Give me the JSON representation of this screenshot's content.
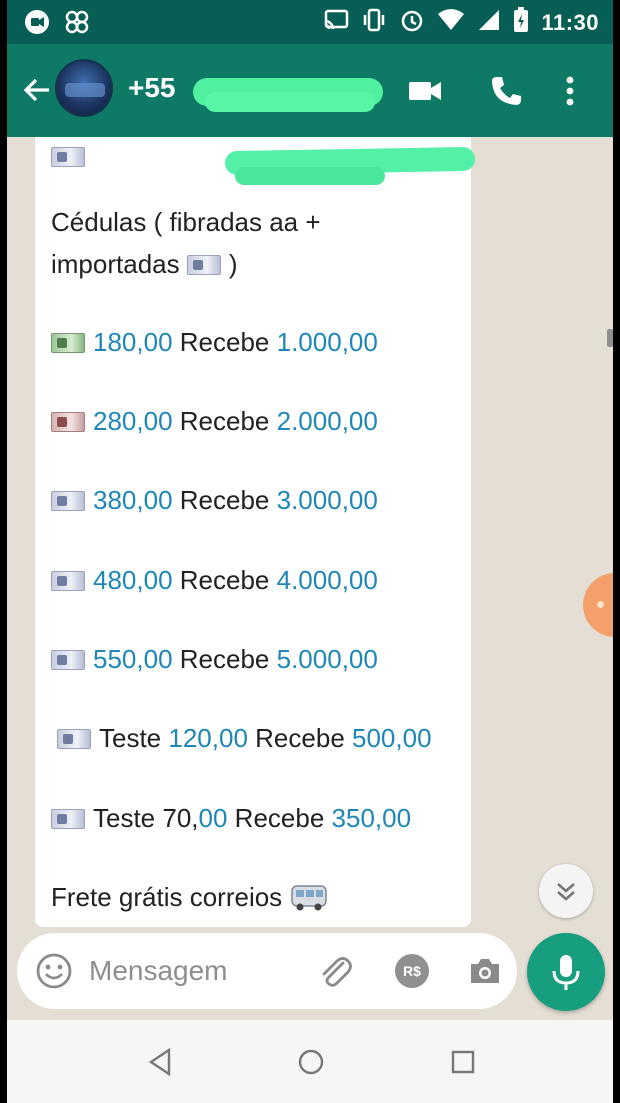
{
  "status_bar": {
    "time": "11:30",
    "icons": [
      "whatsapp-notification-icon",
      "fan-icon",
      "cast-icon",
      "vibrate-icon",
      "alarm-icon",
      "wifi-icon",
      "signal-icon",
      "battery-charging-icon"
    ]
  },
  "app_bar": {
    "contact_prefix": "+55",
    "icons": [
      "back-arrow-icon",
      "video-call-icon",
      "phone-icon",
      "more-vert-icon"
    ]
  },
  "message": {
    "intro_line1": "Cédulas ( fibradas aa +",
    "intro_line2": "importadas",
    "intro_close": ")",
    "offers": [
      {
        "pre": "",
        "price": "180,00",
        "recebe": "Recebe",
        "amount": "1.000,00",
        "bill": "green"
      },
      {
        "pre": "",
        "price": "280,00",
        "recebe": "Recebe",
        "amount": "2.000,00",
        "bill": "red"
      },
      {
        "pre": "",
        "price": "380,00",
        "recebe": "Recebe",
        "amount": "3.000,00",
        "bill": "blue"
      },
      {
        "pre": "",
        "price": "480,00",
        "recebe": "Recebe",
        "amount": "4.000,00",
        "bill": "blue"
      },
      {
        "pre": "",
        "price": "550,00",
        "recebe": "Recebe",
        "amount": "5.000,00",
        "bill": "blue"
      }
    ],
    "teste1": {
      "label": "Teste",
      "price": "120,00",
      "recebe": "Recebe",
      "amount": "500,00"
    },
    "teste2": {
      "label": "Teste 70,",
      "price": "00",
      "recebe": "Recebe",
      "amount": "350,00"
    },
    "frete": "Frete grátis correios"
  },
  "composer": {
    "placeholder": "Mensagem",
    "rs_label": "R$"
  },
  "colors": {
    "header": "#0e7a66",
    "status": "#075e54",
    "number": "#1f86b8",
    "mic": "#179e7f"
  }
}
